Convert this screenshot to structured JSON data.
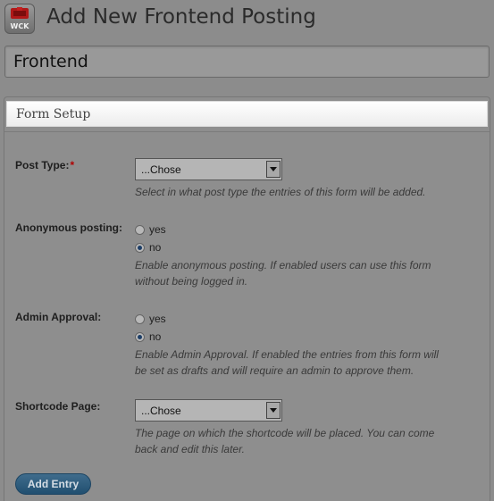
{
  "header": {
    "logo_text": "WCK",
    "title": "Add New Frontend Posting"
  },
  "title_input": {
    "value": "Frontend"
  },
  "metabox": {
    "title": "Form Setup",
    "fields": {
      "post_type": {
        "label": "Post Type:",
        "required_marker": "*",
        "selected": "...Chose",
        "description": "Select in what post type the entries of this form will be added."
      },
      "anonymous_posting": {
        "label": "Anonymous posting:",
        "options": [
          {
            "label": "yes",
            "checked": false
          },
          {
            "label": "no",
            "checked": true
          }
        ],
        "description_line1": "Enable anonymous posting. If enabled users can use this form",
        "description_line2": "without being logged in."
      },
      "admin_approval": {
        "label": "Admin Approval:",
        "options": [
          {
            "label": "yes",
            "checked": false
          },
          {
            "label": "no",
            "checked": true
          }
        ],
        "description_line1": "Enable Admin Approval. If enabled the entries from this form will",
        "description_line2": "be set as drafts and will require an admin to approve them."
      },
      "shortcode_page": {
        "label": "Shortcode Page:",
        "selected": "...Chose",
        "description_line1": "The page on which the shortcode will be placed. You can come",
        "description_line2": "back and edit this later."
      }
    },
    "add_button_label": "Add Entry"
  },
  "colors": {
    "accent_button": "#2b5a7c",
    "required": "#b00000",
    "radio_dot": "#1c3d66"
  },
  "icons": {
    "logo": "wck-logo-icon",
    "dropdown": "chevron-down-icon"
  }
}
